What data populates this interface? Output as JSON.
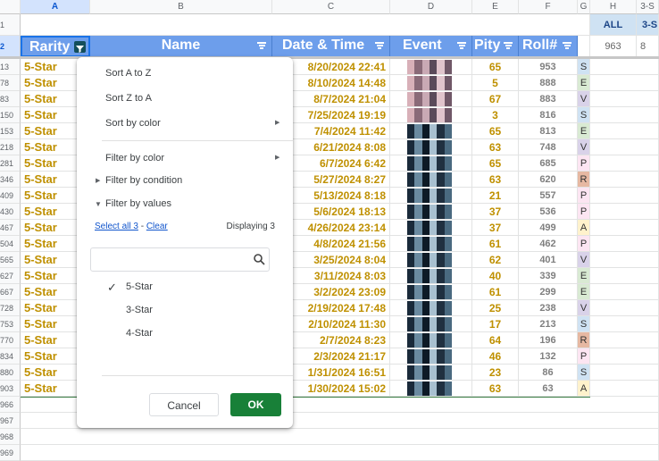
{
  "columns": [
    "A",
    "B",
    "C",
    "D",
    "E",
    "F",
    "G",
    "H",
    "3-S"
  ],
  "row_numbers": [
    "1",
    "2",
    "13",
    "78",
    "83",
    "150",
    "153",
    "218",
    "281",
    "346",
    "409",
    "430",
    "467",
    "504",
    "565",
    "627",
    "667",
    "728",
    "753",
    "770",
    "834",
    "880",
    "903",
    "966",
    "967",
    "968",
    "969"
  ],
  "header": {
    "rarity": "Rarity",
    "name": "Name",
    "date": "Date & Time",
    "event": "Event",
    "pity": "Pity",
    "roll": "Roll#"
  },
  "side_table": {
    "all_label": "ALL",
    "three_star_label": "3-S",
    "all_value": "963",
    "three_star_value": "8"
  },
  "rows": [
    {
      "rarity": "5-Star",
      "date": "8/20/2024 22:41",
      "pity": "65",
      "roll": "953",
      "code": "S",
      "event": "a"
    },
    {
      "rarity": "5-Star",
      "date": "8/10/2024 14:48",
      "pity": "5",
      "roll": "888",
      "code": "E",
      "event": "a"
    },
    {
      "rarity": "5-Star",
      "date": "8/7/2024 21:04",
      "pity": "67",
      "roll": "883",
      "code": "V",
      "event": "a"
    },
    {
      "rarity": "5-Star",
      "date": "7/25/2024 19:19",
      "pity": "3",
      "roll": "816",
      "code": "S",
      "event": "a"
    },
    {
      "rarity": "5-Star",
      "date": "7/4/2024 11:42",
      "pity": "65",
      "roll": "813",
      "code": "E",
      "event": "b"
    },
    {
      "rarity": "5-Star",
      "date": "6/21/2024 8:08",
      "pity": "63",
      "roll": "748",
      "code": "V",
      "event": "b"
    },
    {
      "rarity": "5-Star",
      "date": "6/7/2024 6:42",
      "pity": "65",
      "roll": "685",
      "code": "P",
      "event": "b"
    },
    {
      "rarity": "5-Star",
      "date": "5/27/2024 8:27",
      "pity": "63",
      "roll": "620",
      "code": "R",
      "event": "b"
    },
    {
      "rarity": "5-Star",
      "date": "5/13/2024 8:18",
      "pity": "21",
      "roll": "557",
      "code": "P",
      "event": "b"
    },
    {
      "rarity": "5-Star",
      "date": "5/6/2024 18:13",
      "pity": "37",
      "roll": "536",
      "code": "P",
      "event": "b"
    },
    {
      "rarity": "5-Star",
      "date": "4/26/2024 23:14",
      "pity": "37",
      "roll": "499",
      "code": "A",
      "event": "b"
    },
    {
      "rarity": "5-Star",
      "date": "4/8/2024 21:56",
      "pity": "61",
      "roll": "462",
      "code": "P",
      "event": "b"
    },
    {
      "rarity": "5-Star",
      "date": "3/25/2024 8:04",
      "pity": "62",
      "roll": "401",
      "code": "V",
      "event": "b"
    },
    {
      "rarity": "5-Star",
      "date": "3/11/2024 8:03",
      "pity": "40",
      "roll": "339",
      "code": "E",
      "event": "b"
    },
    {
      "rarity": "5-Star",
      "date": "3/2/2024 23:09",
      "pity": "61",
      "roll": "299",
      "code": "E",
      "event": "b"
    },
    {
      "rarity": "5-Star",
      "date": "2/19/2024 17:48",
      "pity": "25",
      "roll": "238",
      "code": "V",
      "event": "b"
    },
    {
      "rarity": "5-Star",
      "date": "2/10/2024 11:30",
      "pity": "17",
      "roll": "213",
      "code": "S",
      "event": "b"
    },
    {
      "rarity": "5-Star",
      "date": "2/7/2024 8:23",
      "pity": "64",
      "roll": "196",
      "code": "R",
      "event": "b"
    },
    {
      "rarity": "5-Star",
      "date": "2/3/2024 21:17",
      "pity": "46",
      "roll": "132",
      "code": "P",
      "event": "b"
    },
    {
      "rarity": "5-Star",
      "date": "1/31/2024 16:51",
      "pity": "23",
      "roll": "86",
      "code": "S",
      "event": "b"
    },
    {
      "rarity": "5-Star",
      "date": "1/30/2024 15:02",
      "pity": "63",
      "roll": "63",
      "code": "A",
      "event": "b"
    }
  ],
  "code_colors": {
    "S": "#cfe2f3",
    "E": "#d9ead3",
    "V": "#d9d2e9",
    "P": "#fce5f2",
    "R": "#e6b8a2",
    "A": "#fff2cc"
  },
  "filter_menu": {
    "sort_az": "Sort A to Z",
    "sort_za": "Sort Z to A",
    "sort_color": "Sort by color",
    "filter_color": "Filter by color",
    "filter_condition": "Filter by condition",
    "filter_values": "Filter by values",
    "select_all": "Select all 3",
    "separator": "-",
    "clear": "Clear",
    "displaying": "Displaying 3",
    "search_placeholder": "",
    "values": [
      {
        "label": "5-Star",
        "checked": true
      },
      {
        "label": "3-Star",
        "checked": false
      },
      {
        "label": "4-Star",
        "checked": false
      }
    ],
    "cancel": "Cancel",
    "ok": "OK"
  }
}
